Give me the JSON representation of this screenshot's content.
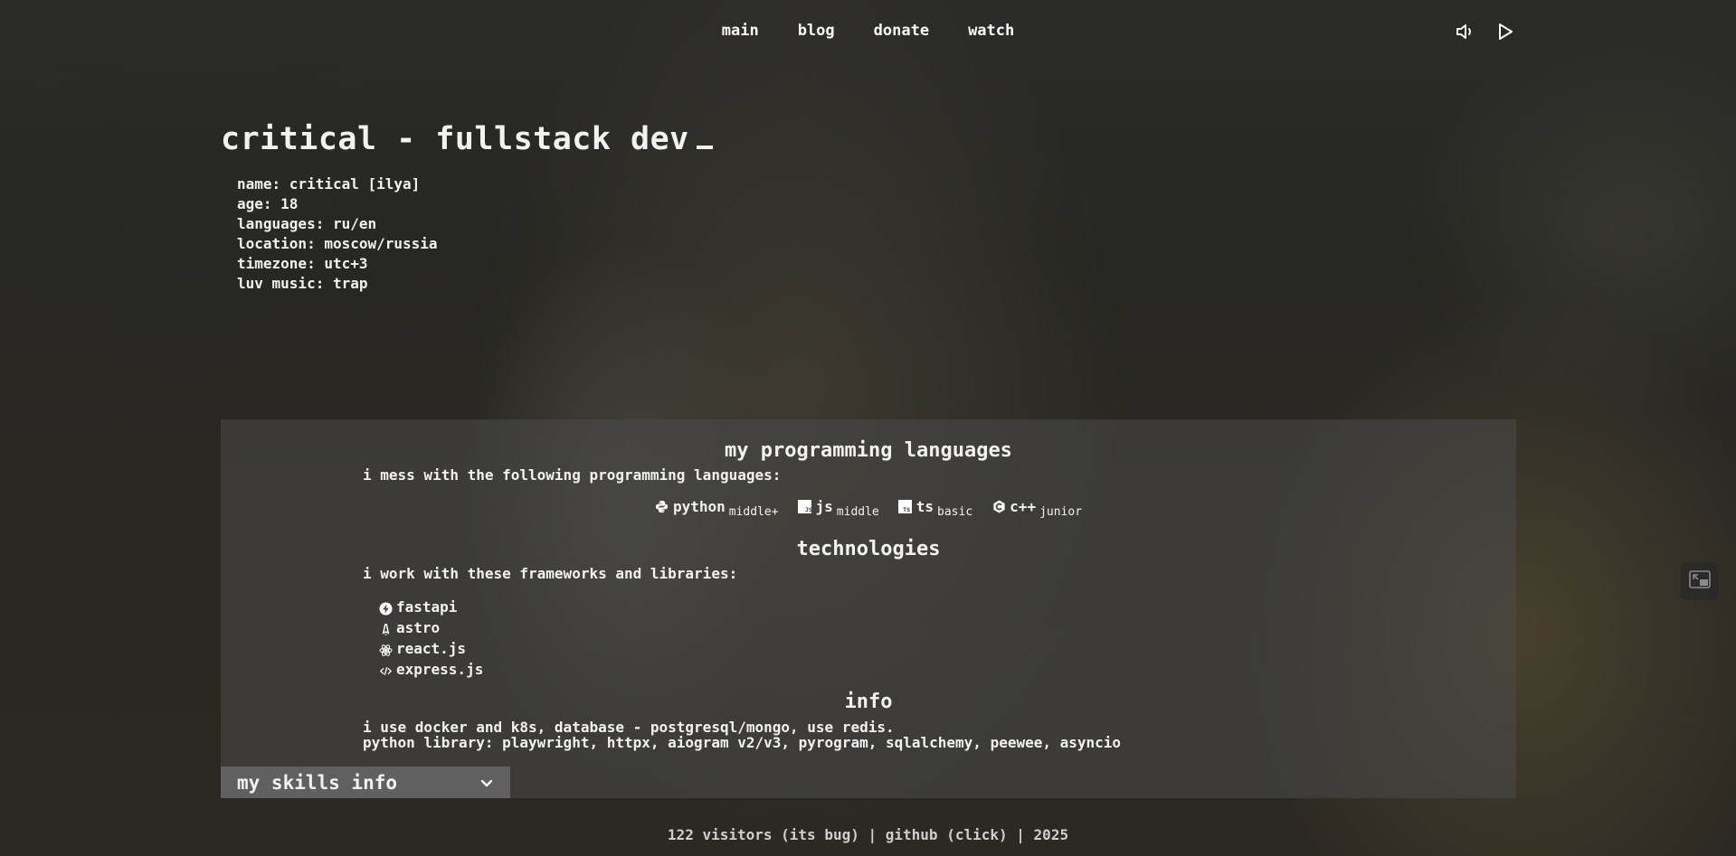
{
  "nav": {
    "items": [
      {
        "label": "main"
      },
      {
        "label": "blog"
      },
      {
        "label": "donate"
      },
      {
        "label": "watch"
      }
    ]
  },
  "media": {
    "volume_icon": "volume-icon",
    "play_icon": "play-icon"
  },
  "header": {
    "title": "critical - fullstack dev"
  },
  "profile": {
    "lines": [
      "name: critical [ilya]",
      "age: 18",
      "languages: ru/en",
      "location: moscow/russia",
      "timezone: utc+3",
      "luv music: trap"
    ]
  },
  "skills": {
    "languages_heading": "my programming languages",
    "languages_intro": "i mess with the following programming languages:",
    "languages": [
      {
        "name": "python",
        "level": "middle+",
        "icon": "python-icon"
      },
      {
        "name": "js",
        "level": "middle",
        "icon": "js-icon"
      },
      {
        "name": "ts",
        "level": "basic",
        "icon": "ts-icon"
      },
      {
        "name": "c++",
        "level": "junior",
        "icon": "cpp-icon"
      }
    ],
    "tech_heading": "technologies",
    "tech_intro": "i work with these frameworks and libraries:",
    "technologies": [
      {
        "name": "fastapi",
        "icon": "fastapi-icon"
      },
      {
        "name": "astro",
        "icon": "astro-icon"
      },
      {
        "name": "react.js",
        "icon": "react-icon"
      },
      {
        "name": "express.js",
        "icon": "code-icon"
      }
    ],
    "info_heading": "info",
    "info_lines": [
      "i use docker and k8s, database - postgresql/mongo, use redis.",
      "python library: playwright, httpx, aiogram v2/v3, pyrogram, sqlalchemy, peewee, asyncio"
    ],
    "toggle_label": "my skills info"
  },
  "footer": {
    "visitors": "122 visitors (its bug)",
    "separator": "|",
    "github": "github (click)",
    "year": "2025"
  },
  "colors": {
    "text": "#f2f2f2",
    "panel": "#4b4b4b",
    "footer_text": "#cfcfcf"
  }
}
